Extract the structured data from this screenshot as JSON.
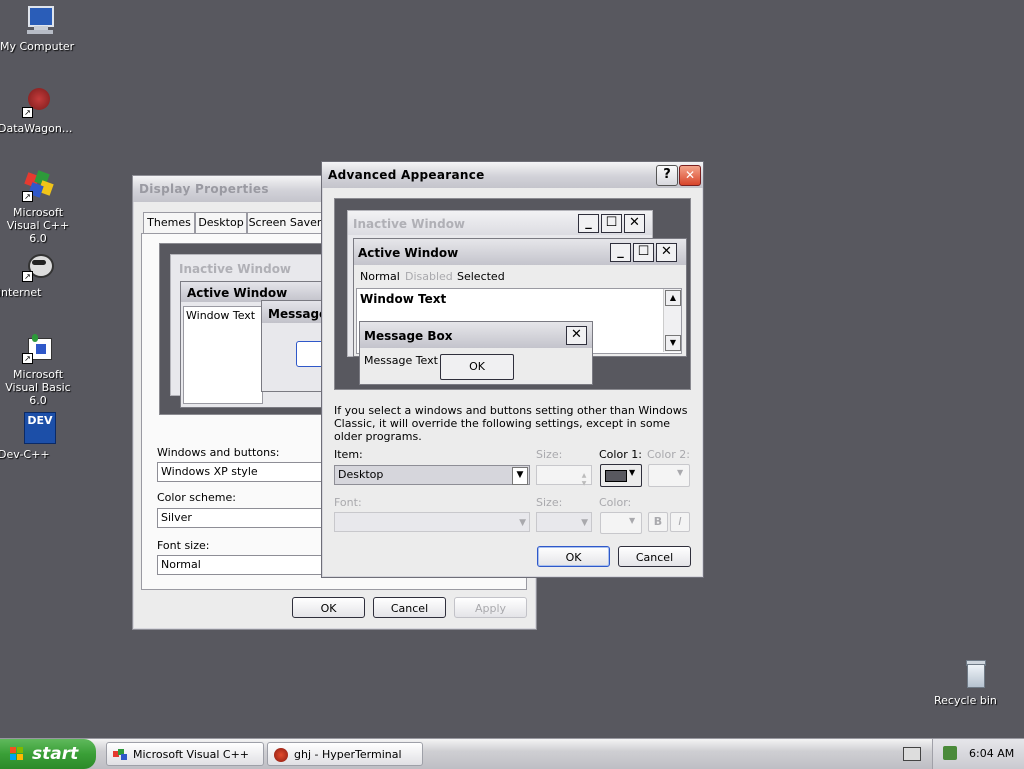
{
  "desktop": {
    "icons": [
      {
        "label": "My Computer"
      },
      {
        "label": "DataWagon..."
      },
      {
        "label": "Microsoft Visual C++ 6.0"
      },
      {
        "label": "internet"
      },
      {
        "label": "Microsoft Visual Basic 6.0"
      },
      {
        "label": "Dev-C++"
      },
      {
        "label": "Recycle bin"
      }
    ]
  },
  "display_properties": {
    "title": "Display Properties",
    "tabs": [
      "Themes",
      "Desktop",
      "Screen Saver"
    ],
    "preview": {
      "inactive_window": "Inactive Window",
      "active_window": "Active Window",
      "window_text": "Window Text",
      "message": "Message"
    },
    "windows_and_buttons_label": "Windows and buttons:",
    "windows_and_buttons_value": "Windows XP style",
    "color_scheme_label": "Color scheme:",
    "color_scheme_value": "Silver",
    "font_size_label": "Font size:",
    "font_size_value": "Normal",
    "ok": "OK",
    "cancel": "Cancel",
    "apply": "Apply"
  },
  "advanced_appearance": {
    "title": "Advanced Appearance",
    "help_glyph": "?",
    "close_glyph": "✕",
    "preview": {
      "inactive_window": "Inactive Window",
      "active_window": "Active Window",
      "menu_normal": "Normal",
      "menu_disabled": "Disabled",
      "menu_selected": "Selected",
      "window_text": "Window Text",
      "message_box": "Message Box",
      "message_text": "Message Text",
      "ok": "OK"
    },
    "info_text": "If you select a windows and buttons setting other than Windows Classic, it will override the following settings, except in some older programs.",
    "item_label": "Item:",
    "item_value": "Desktop",
    "size_label": "Size:",
    "color1_label": "Color 1:",
    "color2_label": "Color 2:",
    "font_label": "Font:",
    "size2_label": "Size:",
    "color3_label": "Color:",
    "bold_label": "B",
    "italic_label": "I",
    "ok": "OK",
    "cancel": "Cancel",
    "color1_swatch": "#58585f"
  },
  "taskbar": {
    "start_label": "start",
    "tasks": [
      "Microsoft Visual C++",
      "ghj - HyperTerminal"
    ],
    "clock": "6:04 AM"
  }
}
